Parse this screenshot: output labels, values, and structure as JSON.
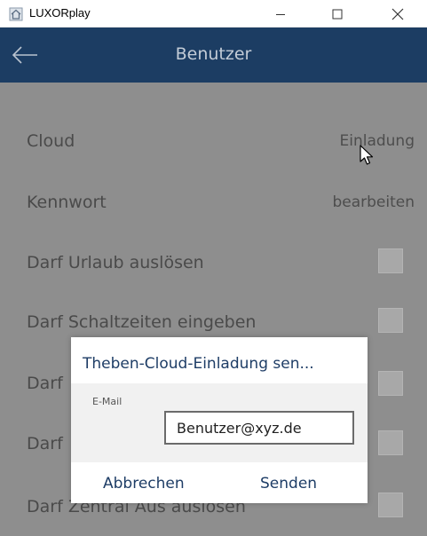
{
  "window": {
    "title": "LUXORplay",
    "minimize_icon": "minimize-icon",
    "maximize_icon": "maximize-icon",
    "close_icon": "close-icon"
  },
  "header": {
    "title": "Benutzer",
    "back_icon": "back-arrow-icon",
    "background": "#1c3d63"
  },
  "rows": [
    {
      "label": "Cloud",
      "action": "Einladung"
    },
    {
      "label": "Kennwort",
      "action": "bearbeiten"
    },
    {
      "label": "Darf Urlaub auslösen",
      "checked": false
    },
    {
      "label": "Darf Schaltzeiten eingeben",
      "checked": false
    },
    {
      "label": "Darf",
      "checked": false
    },
    {
      "label": "Darf",
      "checked": false
    },
    {
      "label": "Darf Zentral Aus auslösen",
      "checked": false
    }
  ],
  "dialog": {
    "title": "Theben-Cloud-Einladung sen...",
    "field_label": "E-Mail",
    "email_value": "Benutzer@xyz.de",
    "cancel_label": "Abbrechen",
    "send_label": "Senden",
    "accent": "#1e3d66"
  }
}
